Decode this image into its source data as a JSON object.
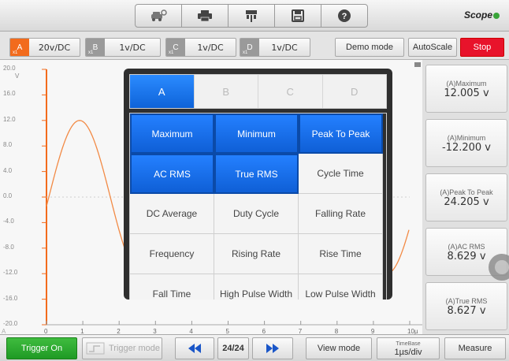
{
  "app": {
    "logo_text": "Scope"
  },
  "channels": [
    {
      "letter": "A",
      "sub": "x1",
      "value": "20v/DC",
      "color": "#f26b1d"
    },
    {
      "letter": "B",
      "sub": "x1",
      "value": "1v/DC",
      "color": "#9a9a9a"
    },
    {
      "letter": "C",
      "sub": "x1",
      "value": "1v/DC",
      "color": "#9a9a9a"
    },
    {
      "letter": "D",
      "sub": "x1",
      "value": "1v/DC",
      "color": "#9a9a9a"
    }
  ],
  "header_buttons": {
    "demo_mode": "Demo mode",
    "autoscale": "AutoScale",
    "stop": "Stop"
  },
  "plot": {
    "y_labels": [
      "20.0",
      "16.0",
      "12.0",
      "8.0",
      "4.0",
      "0.0",
      "-4.0",
      "-8.0",
      "-12.0",
      "-16.0",
      "-20.0"
    ],
    "y_unit": "V",
    "x_labels": [
      "0",
      "1",
      "2",
      "3",
      "4",
      "5",
      "6",
      "7",
      "8",
      "9",
      "10µ"
    ],
    "x_corner": "A",
    "trace_color": "#f28a45"
  },
  "popup": {
    "tabs": [
      {
        "label": "A",
        "active": true
      },
      {
        "label": "B",
        "active": false
      },
      {
        "label": "C",
        "active": false
      },
      {
        "label": "D",
        "active": false
      }
    ],
    "options": [
      {
        "label": "Maximum",
        "selected": true
      },
      {
        "label": "Minimum",
        "selected": true
      },
      {
        "label": "Peak To Peak",
        "selected": true
      },
      {
        "label": "AC RMS",
        "selected": true
      },
      {
        "label": "True RMS",
        "selected": true
      },
      {
        "label": "Cycle Time",
        "selected": false
      },
      {
        "label": "DC Average",
        "selected": false
      },
      {
        "label": "Duty Cycle",
        "selected": false
      },
      {
        "label": "Falling Rate",
        "selected": false
      },
      {
        "label": "Frequency",
        "selected": false
      },
      {
        "label": "Rising Rate",
        "selected": false
      },
      {
        "label": "Rise Time",
        "selected": false
      },
      {
        "label": "Fall Time",
        "selected": false
      },
      {
        "label": "High Pulse Width",
        "selected": false
      },
      {
        "label": "Low Pulse Width",
        "selected": false
      }
    ]
  },
  "measurements": [
    {
      "label": "(A)Maximum",
      "value": "12.005 v"
    },
    {
      "label": "(A)Minimum",
      "value": "-12.200 v"
    },
    {
      "label": "(A)Peak To Peak",
      "value": "24.205 v"
    },
    {
      "label": "(A)AC RMS",
      "value": "8.629 v"
    },
    {
      "label": "(A)True RMS",
      "value": "8.627 v"
    }
  ],
  "bottom": {
    "trigger_on": "Trigger On",
    "trigger_mode": "Trigger mode",
    "page": "24/24",
    "view_mode": "View mode",
    "timebase_label": "TimeBase",
    "timebase_value": "1µs/div",
    "measure": "Measure"
  }
}
